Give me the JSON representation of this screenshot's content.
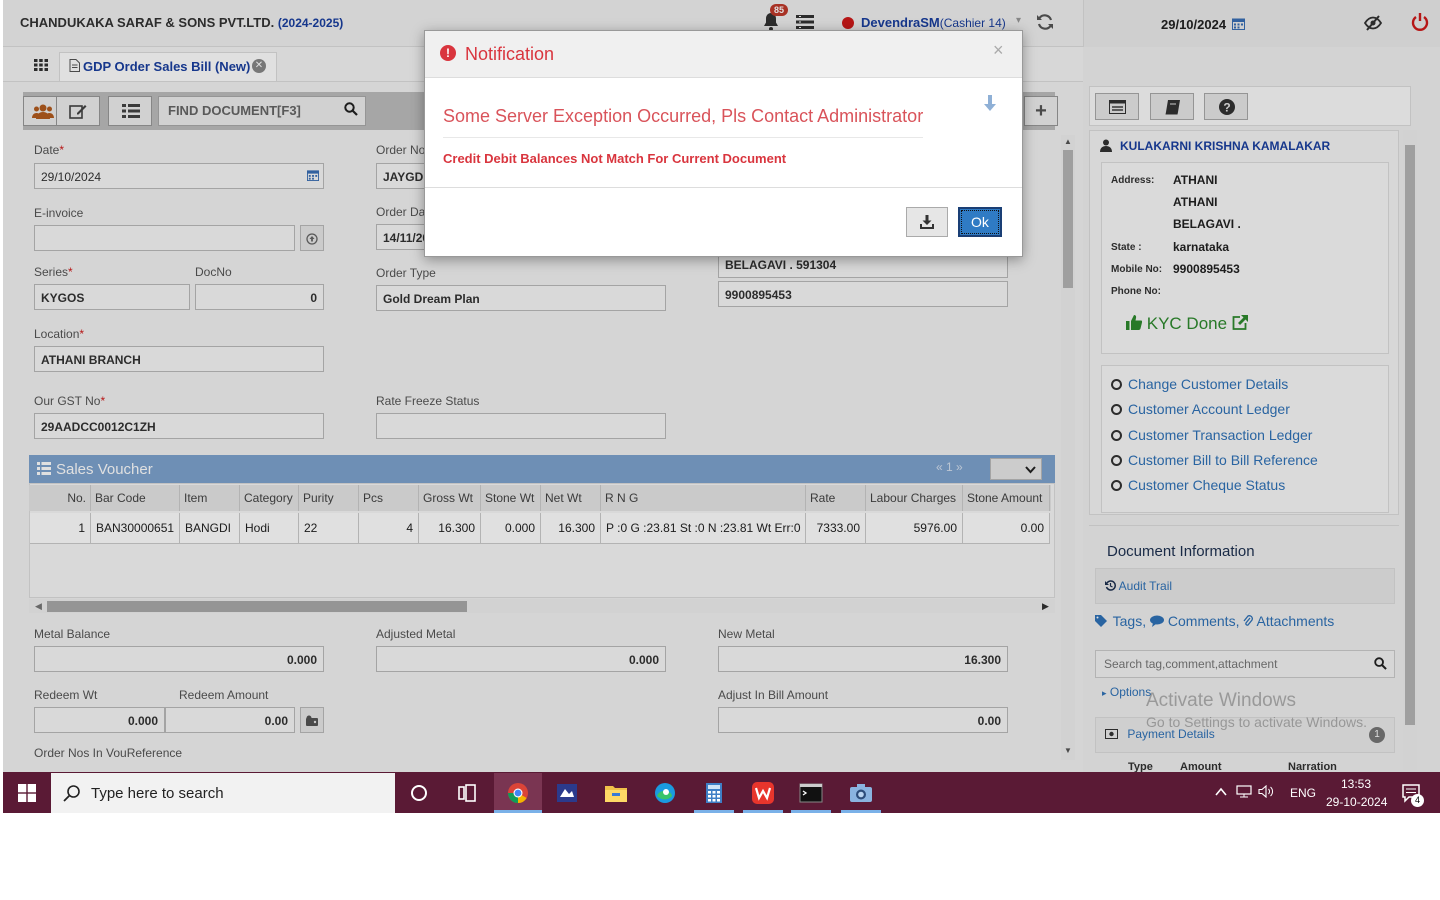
{
  "header": {
    "company": "CHANDUKAKA SARAF & SONS PVT.LTD.",
    "year": "(2024-2025)",
    "notification_count": "85",
    "user_name": "DevendraSM",
    "user_role": "(Cashier 14)",
    "date": "29/10/2024"
  },
  "tab": {
    "label": "GDP Order Sales Bill (New)"
  },
  "toolbar": {
    "find_label": "FIND DOCUMENT[F3]"
  },
  "form": {
    "date_label": "Date",
    "date_value": "29/10/2024",
    "order_no_label": "Order No",
    "order_no_value": "JAYGD",
    "einvoice_label": "E-invoice",
    "einvoice_value": "",
    "order_date_label": "Order Da",
    "order_date_value": "14/11/20",
    "series_label": "Series",
    "series_value": "KYGOS",
    "docno_label": "DocNo",
    "docno_value": "0",
    "order_type_label": "Order Type",
    "order_type_value": "Gold Dream Plan",
    "address_line": "BELAGAVI . 591304",
    "phone_value": "9900895453",
    "location_label": "Location",
    "location_value": "ATHANI BRANCH",
    "gst_label": "Our GST No",
    "gst_value": "29AADCC0012C1ZH",
    "rate_freeze_label": "Rate Freeze Status",
    "rate_freeze_value": ""
  },
  "sales_voucher": {
    "title": "Sales Voucher",
    "pager": "« 1 »",
    "columns": [
      "No.",
      "Bar Code",
      "Item",
      "Category",
      "Purity",
      "Pcs",
      "Gross Wt",
      "Stone Wt",
      "Net Wt",
      "R N G",
      "Rate",
      "Labour Charges",
      "Stone Amount"
    ],
    "rows": [
      [
        "1",
        "BAN30000651",
        "BANGDI",
        "Hodi",
        "22",
        "4",
        "16.300",
        "0.000",
        "16.300",
        "P :0 G :23.81 St :0 N :23.81 Wt Err:0",
        "7333.00",
        "5976.00",
        "0.00"
      ]
    ]
  },
  "balances": {
    "metal_balance_label": "Metal Balance",
    "metal_balance_value": "0.000",
    "adjusted_metal_label": "Adjusted Metal",
    "adjusted_metal_value": "0.000",
    "new_metal_label": "New Metal",
    "new_metal_value": "16.300",
    "redeem_wt_label": "Redeem Wt",
    "redeem_wt_value": "0.000",
    "redeem_amount_label": "Redeem Amount",
    "redeem_amount_value": "0.00",
    "adjust_in_bill_label": "Adjust In Bill Amount",
    "adjust_in_bill_value": "0.00",
    "order_nos_label": "Order Nos In VouReference"
  },
  "customer": {
    "name": "KULAKARNI KRISHNA KAMALAKAR",
    "address_label": "Address:",
    "address_lines": [
      "ATHANI",
      "ATHANI",
      "BELAGAVI ."
    ],
    "state_label": "State :",
    "state_value": "karnataka",
    "mobile_label": "Mobile No:",
    "mobile_value": "9900895453",
    "phone_label": "Phone No:",
    "phone_value": "",
    "kyc": "KYC Done",
    "links": [
      "Change Customer Details",
      "Customer Account Ledger",
      "Customer Transaction Ledger",
      "Customer Bill to Bill Reference",
      "Customer Cheque Status"
    ]
  },
  "doc_info": {
    "title": "Document Information",
    "audit_trail": "Audit Trail",
    "tags": "Tags,",
    "comments": "Comments,",
    "attachments": "Attachments",
    "search_placeholder": "Search tag,comment,attachment",
    "options": "Options",
    "payment_details": "Payment Details",
    "payment_count": "1",
    "payment_cols": [
      "Type",
      "Amount",
      "Narration"
    ]
  },
  "watermark": {
    "line1": "Activate Windows",
    "line2": "Go to Settings to activate Windows."
  },
  "modal": {
    "title": "Notification",
    "message": "Some Server Exception Occurred, Pls Contact Administrator",
    "detail": "Credit Debit Balances Not Match For Current Document",
    "ok_label": "Ok"
  },
  "taskbar": {
    "search_placeholder": "Type here to search",
    "lang": "ENG",
    "time": "13:53",
    "date": "29-10-2024",
    "notifications": "4"
  }
}
